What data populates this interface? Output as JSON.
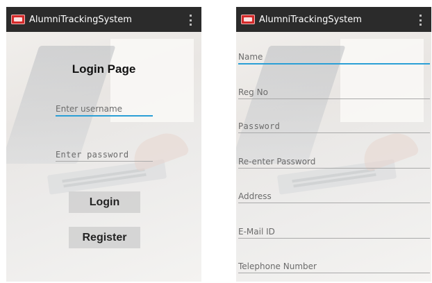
{
  "colors": {
    "appbar": "#2b2b2b",
    "accent": "#2a9fd6",
    "app_icon": "#d42a2a",
    "button": "#d3d3d3"
  },
  "login_screen": {
    "appbar": {
      "title": "AlumniTrackingSystem",
      "icon": "app-logo-icon",
      "menu_icon": "overflow-menu-icon"
    },
    "title": "Login Page",
    "username": {
      "placeholder": "Enter username",
      "value": ""
    },
    "password": {
      "placeholder": "Enter password",
      "value": ""
    },
    "login_label": "Login",
    "register_label": "Register"
  },
  "register_screen": {
    "appbar": {
      "title": "AlumniTrackingSystem",
      "icon": "app-logo-icon",
      "menu_icon": "overflow-menu-icon"
    },
    "fields": [
      {
        "placeholder": "Name"
      },
      {
        "placeholder": "Reg No"
      },
      {
        "placeholder": "Password"
      },
      {
        "placeholder": "Re-enter Password"
      },
      {
        "placeholder": "Address"
      },
      {
        "placeholder": "E-Mail ID"
      },
      {
        "placeholder": "Telephone Number"
      }
    ]
  }
}
